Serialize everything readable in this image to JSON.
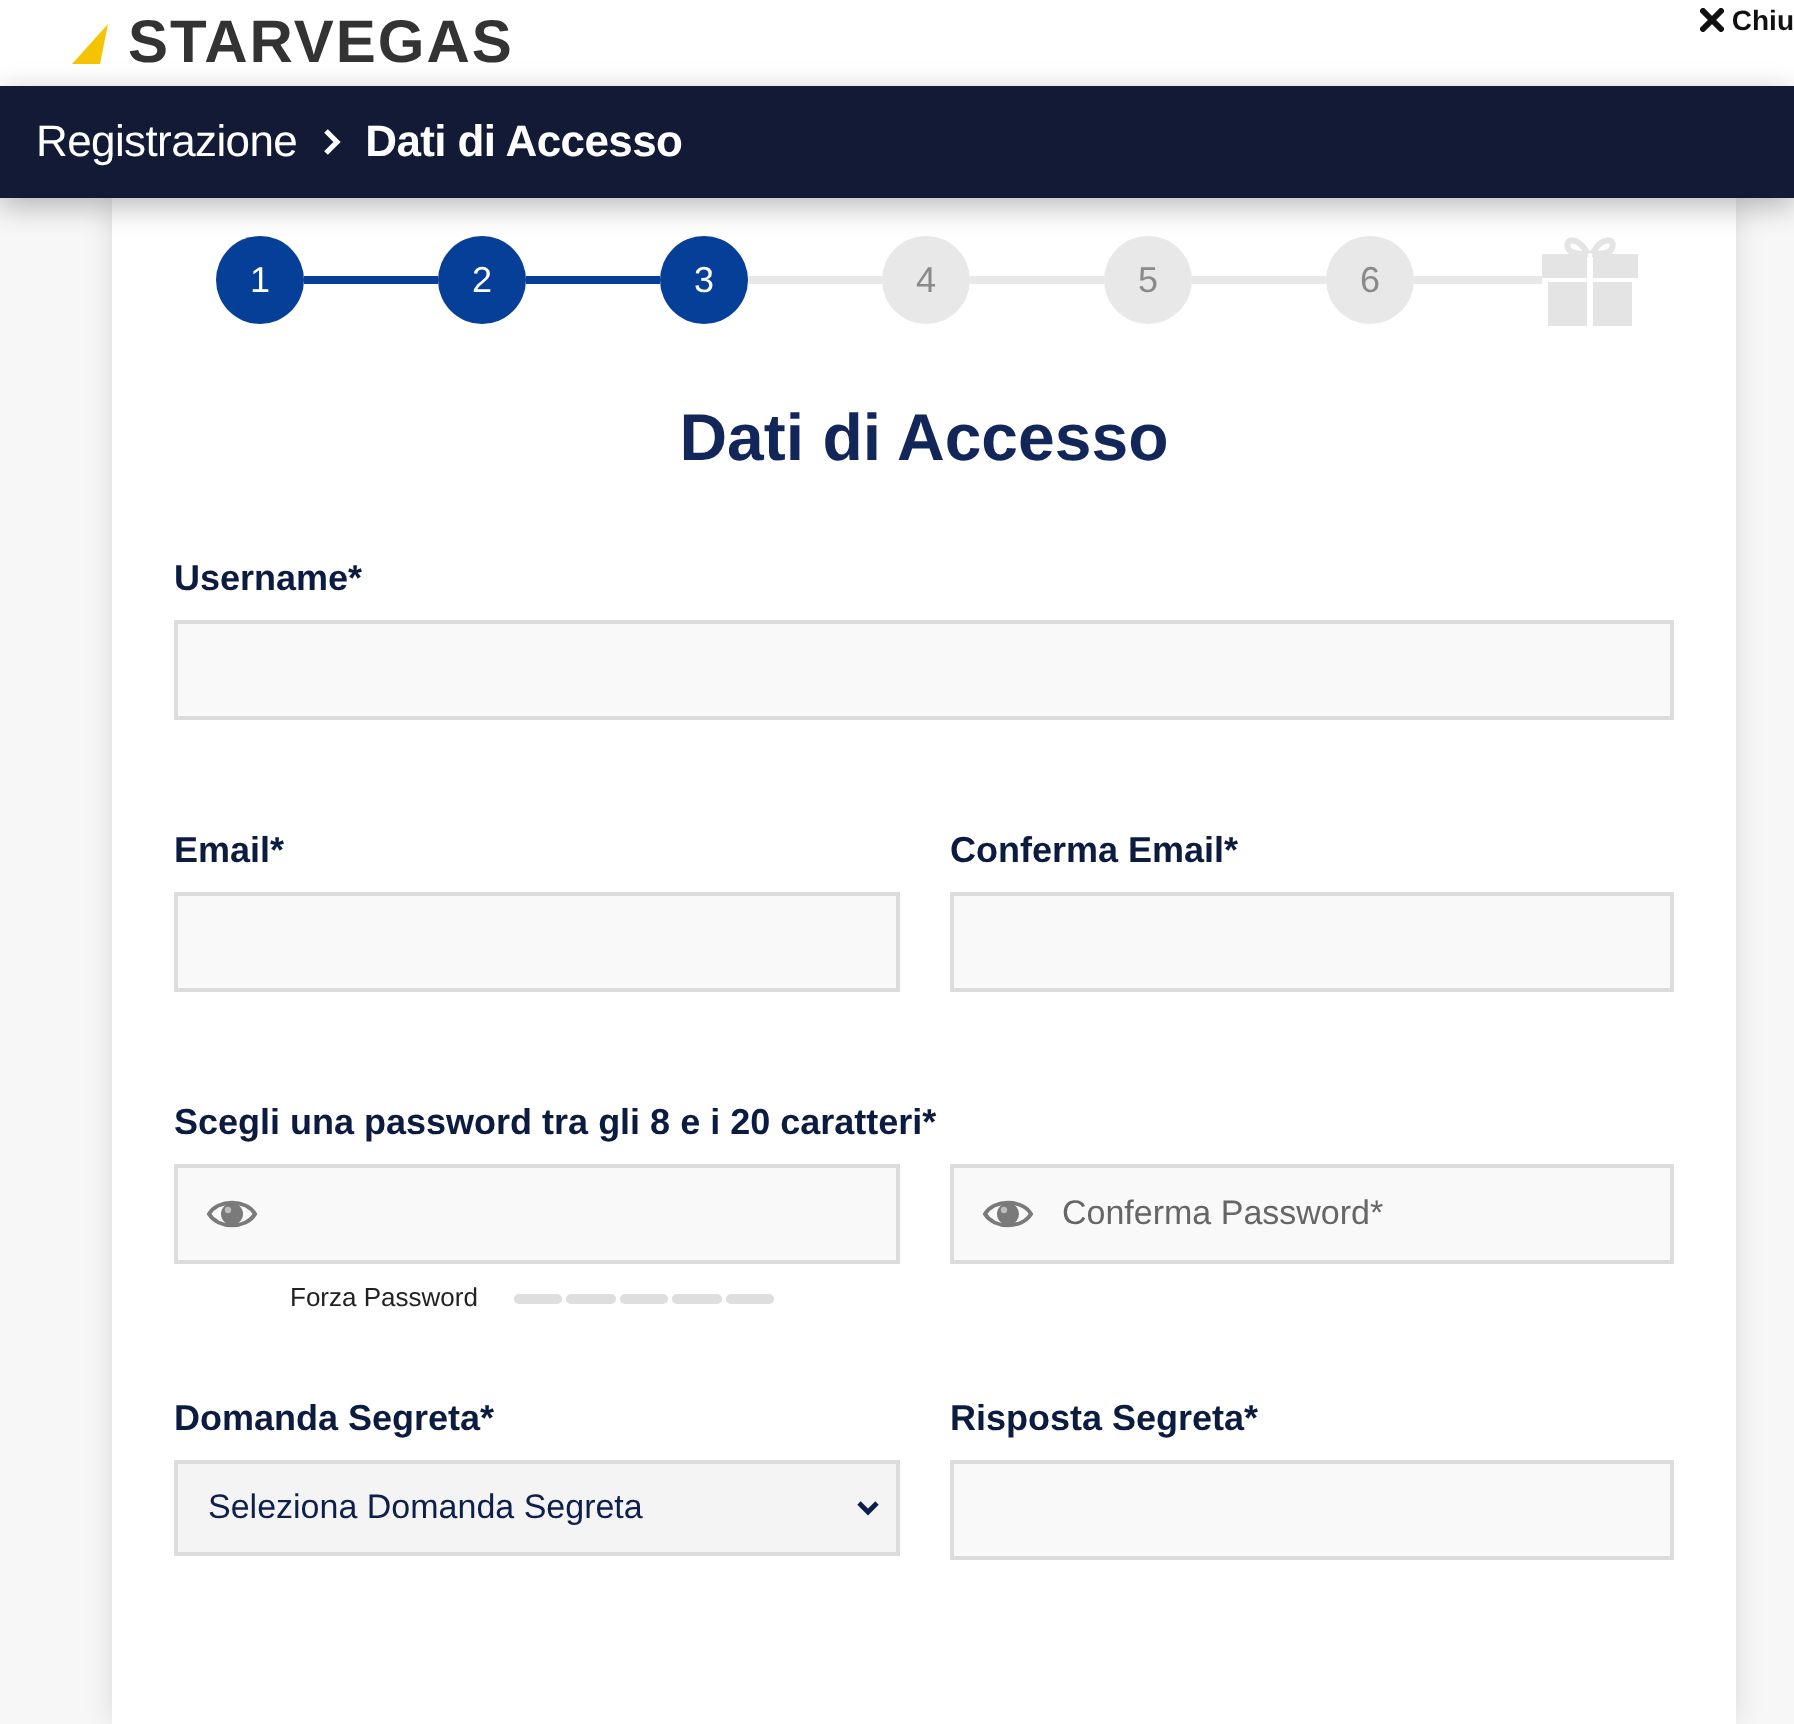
{
  "header": {
    "logo": "STARVEGAS",
    "close_label": "Chiu"
  },
  "breadcrumb": [
    {
      "label": "Registrazione",
      "current": false
    },
    {
      "label": "Dati di Accesso",
      "current": true
    }
  ],
  "stepper": {
    "steps": [
      {
        "label": "1",
        "done": true
      },
      {
        "label": "2",
        "done": true
      },
      {
        "label": "3",
        "done": true
      },
      {
        "label": "4",
        "done": false
      },
      {
        "label": "5",
        "done": false
      },
      {
        "label": "6",
        "done": false
      }
    ]
  },
  "title": "Dati di Accesso",
  "rows": [
    {
      "fields": [
        {
          "kind": "text",
          "label": "Username*"
        }
      ]
    },
    {
      "fields": [
        {
          "kind": "text",
          "label": "Email*"
        },
        {
          "kind": "text",
          "label": "Conferma Email*"
        }
      ]
    },
    {
      "label": "Scegli una password tra gli 8 e i 20 caratteri*",
      "fields": [
        {
          "kind": "password",
          "strength": {
            "label": "Forza Password"
          }
        },
        {
          "kind": "password",
          "placeholder": "Conferma Password*"
        }
      ]
    },
    {
      "fields": [
        {
          "kind": "select",
          "label": "Domanda Segreta*",
          "value": "Seleziona Domanda Segreta"
        },
        {
          "kind": "text",
          "label": "Risposta Segreta*"
        }
      ]
    }
  ]
}
